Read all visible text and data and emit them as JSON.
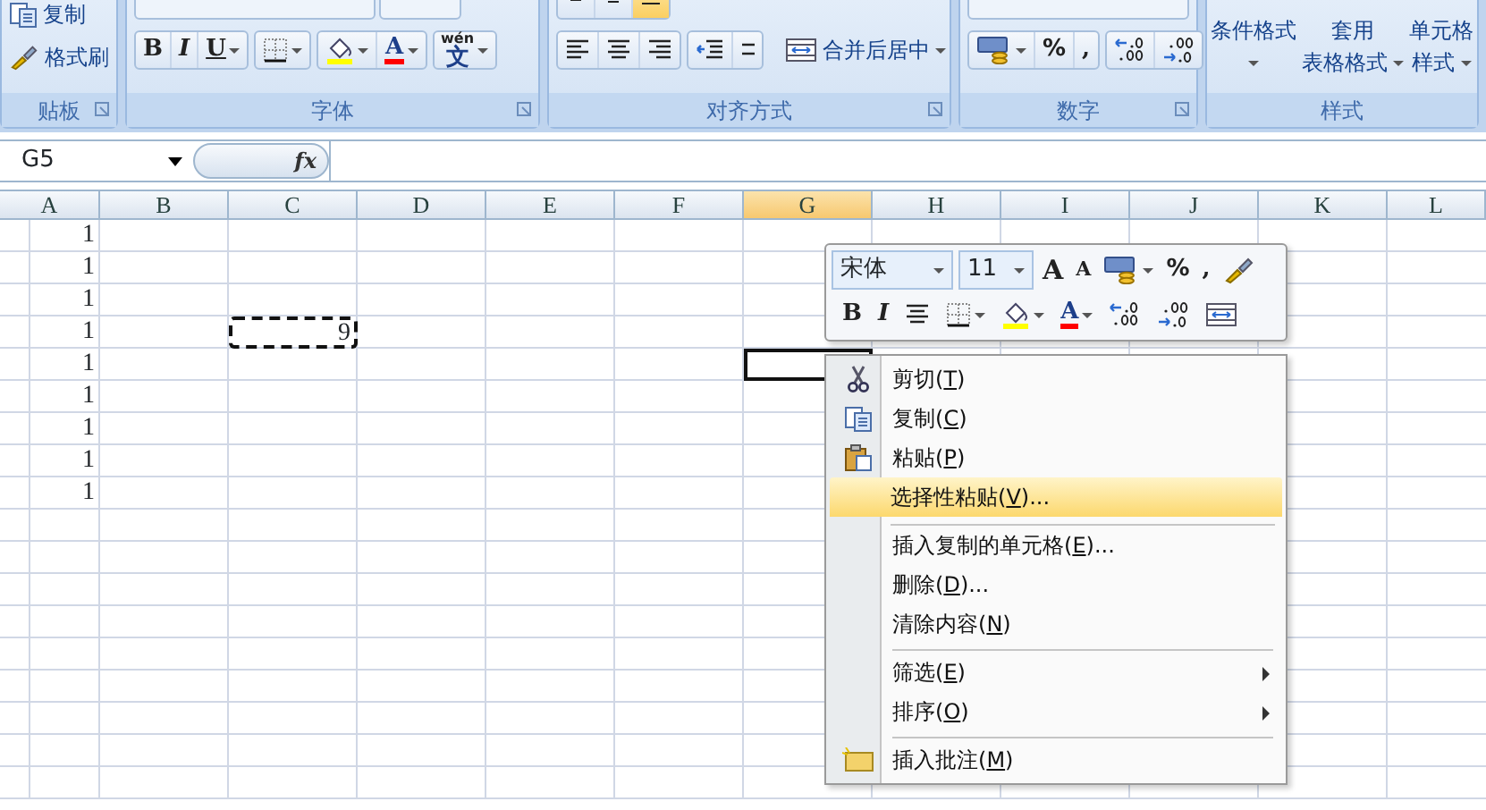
{
  "ribbon": {
    "groups": [
      {
        "kind": "clipboard",
        "label": "贴板",
        "items": [
          {
            "kind": "copy",
            "label": "复制"
          },
          {
            "kind": "brush",
            "label": "格式刷"
          }
        ]
      },
      {
        "kind": "font",
        "label": "字体",
        "tools": [
          {
            "kind": "bold",
            "label": "B",
            "dropdown": false
          },
          {
            "kind": "italic",
            "label": "I",
            "dropdown": false
          },
          {
            "kind": "underline",
            "label": "U",
            "dropdown": true
          },
          {
            "kind": "border",
            "dropdown": true
          },
          {
            "kind": "fill",
            "dropdown": true
          },
          {
            "kind": "font_color",
            "label": "A",
            "dropdown": true
          },
          {
            "kind": "phonetic",
            "label": "文",
            "sublabel": "wén",
            "dropdown": true
          }
        ]
      },
      {
        "kind": "alignment",
        "label": "对齐方式",
        "top_tools": [
          {
            "kind": "align_top",
            "selected": false
          },
          {
            "kind": "align_middle",
            "selected": false
          },
          {
            "kind": "align_bottom",
            "selected": true
          }
        ],
        "tools": [
          {
            "kind": "align_left"
          },
          {
            "kind": "align_center"
          },
          {
            "kind": "align_right"
          },
          {
            "kind": "decrease_indent"
          },
          {
            "kind": "increase_indent"
          }
        ],
        "merge": {
          "label": "合并后居中",
          "dropdown": true
        }
      },
      {
        "kind": "number",
        "label": "数字",
        "tools": [
          {
            "kind": "currency",
            "dropdown": true
          },
          {
            "kind": "percent",
            "label": "%"
          },
          {
            "kind": "comma",
            "label": ","
          },
          {
            "kind": "increase_decimal"
          },
          {
            "kind": "decrease_decimal"
          }
        ]
      },
      {
        "kind": "styles",
        "label": "样式",
        "items": [
          {
            "lines": [
              "条件格式"
            ],
            "dropdown": true
          },
          {
            "lines": [
              "套用",
              "表格格式"
            ],
            "dropdown": true
          },
          {
            "lines": [
              "单元格",
              "样式"
            ],
            "dropdown": true
          }
        ]
      }
    ]
  },
  "formula_bar": {
    "name_box": "G5",
    "function_button": "fx"
  },
  "columns": [
    {
      "label": "A",
      "selected": false
    },
    {
      "label": "B",
      "selected": false
    },
    {
      "label": "C",
      "selected": false
    },
    {
      "label": "D",
      "selected": false
    },
    {
      "label": "E",
      "selected": false
    },
    {
      "label": "F",
      "selected": false
    },
    {
      "label": "G",
      "selected": true
    },
    {
      "label": "H",
      "selected": false
    },
    {
      "label": "I",
      "selected": false
    },
    {
      "label": "J",
      "selected": false
    },
    {
      "label": "K",
      "selected": false
    },
    {
      "label": "L",
      "selected": false
    }
  ],
  "rows": [
    {
      "cells": {
        "A": {
          "value": "1"
        }
      }
    },
    {
      "cells": {
        "A": {
          "value": "1"
        }
      }
    },
    {
      "cells": {
        "A": {
          "value": "1"
        }
      }
    },
    {
      "cells": {
        "A": {
          "value": "1"
        },
        "C": {
          "value": "9",
          "copied": true
        }
      }
    },
    {
      "cells": {
        "A": {
          "value": "1"
        },
        "G": {
          "selected": true
        }
      }
    },
    {
      "cells": {
        "A": {
          "value": "1"
        }
      }
    },
    {
      "cells": {
        "A": {
          "value": "1"
        }
      }
    },
    {
      "cells": {
        "A": {
          "value": "1"
        }
      }
    },
    {
      "cells": {
        "A": {
          "value": "1"
        }
      }
    }
  ],
  "mini_toolbar": {
    "font": "宋体",
    "size": "11",
    "tools_row_1": [
      {
        "kind": "grow_font",
        "label": "A"
      },
      {
        "kind": "shrink_font",
        "label": "A"
      },
      {
        "kind": "currency",
        "dropdown": true
      },
      {
        "kind": "percent",
        "label": "%"
      },
      {
        "kind": "comma",
        "label": ","
      },
      {
        "kind": "brush"
      }
    ],
    "tools_row_2": [
      {
        "kind": "bold",
        "label": "B"
      },
      {
        "kind": "italic",
        "label": "I"
      },
      {
        "kind": "center"
      },
      {
        "kind": "border",
        "dropdown": true
      },
      {
        "kind": "fill",
        "dropdown": true
      },
      {
        "kind": "font_color",
        "label": "A",
        "dropdown": true
      },
      {
        "kind": "increase_decimal"
      },
      {
        "kind": "decrease_decimal"
      },
      {
        "kind": "merge"
      }
    ]
  },
  "context_menu": [
    {
      "kind": "cut",
      "label": "剪切(T)",
      "selected": false,
      "submenu": false,
      "separator_after": false
    },
    {
      "kind": "copy",
      "label": "复制(C)",
      "selected": false,
      "submenu": false,
      "separator_after": false
    },
    {
      "kind": "paste",
      "label": "粘贴(P)",
      "selected": false,
      "submenu": false,
      "separator_after": false
    },
    {
      "kind": "plain",
      "label": "选择性粘贴(V)...",
      "selected": true,
      "submenu": false,
      "separator_after": true
    },
    {
      "kind": "plain",
      "label": "插入复制的单元格(E)...",
      "selected": false,
      "submenu": false,
      "separator_after": false
    },
    {
      "kind": "plain",
      "label": "删除(D)...",
      "selected": false,
      "submenu": false,
      "separator_after": false
    },
    {
      "kind": "plain",
      "label": "清除内容(N)",
      "selected": false,
      "submenu": false,
      "separator_after": true
    },
    {
      "kind": "plain",
      "label": "筛选(E)",
      "selected": false,
      "submenu": true,
      "separator_after": false
    },
    {
      "kind": "plain",
      "label": "排序(O)",
      "selected": false,
      "submenu": true,
      "separator_after": true
    },
    {
      "kind": "comment",
      "label": "插入批注(M)",
      "selected": false,
      "submenu": false,
      "separator_after": false
    }
  ]
}
